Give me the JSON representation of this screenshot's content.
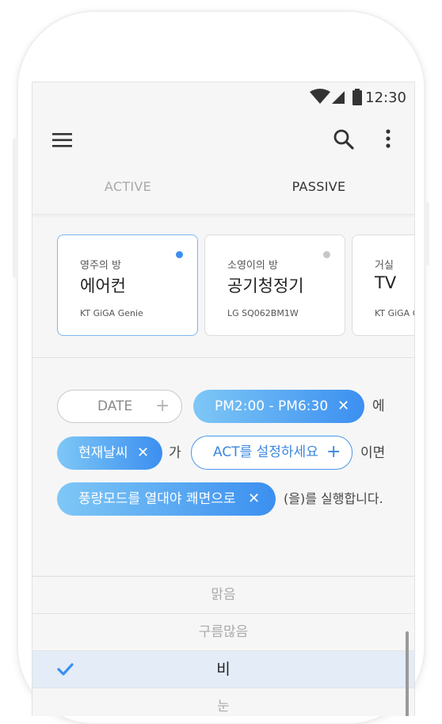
{
  "status_bar": {
    "time": "12:30"
  },
  "tabs": [
    {
      "label": "ACTIVE"
    },
    {
      "label": "PASSIVE"
    }
  ],
  "devices": [
    {
      "room": "영주의 방",
      "name": "에어컨",
      "model": "KT GiGA Genie",
      "indicator_color": "#3b8ff0"
    },
    {
      "room": "소영이의 방",
      "name": "공기청정기",
      "model": "LG SQ062BM1W",
      "indicator_color": "#c7c7c7"
    },
    {
      "room": "거실",
      "name": "TV",
      "model": "KT GiGA G"
    }
  ],
  "rule": {
    "date_chip": "DATE",
    "time_chip": "PM2:00 - PM6:30",
    "conn_1": "에",
    "weather_chip": "현재날씨",
    "conn_2": "가",
    "act_chip": "ACT를 설정하세요",
    "conn_3": "이면",
    "action_chip": "풍량모드를 열대야 쾌면으로",
    "conn_4": "(을)를 실행합니다."
  },
  "picker": {
    "options": [
      "맑음",
      "구름많음",
      "비",
      "눈"
    ],
    "selected": "비"
  },
  "colors": {
    "accent": "#3b8ff0",
    "accent_light": "#7ec7f6",
    "selected_row": "#e3ecf7"
  }
}
